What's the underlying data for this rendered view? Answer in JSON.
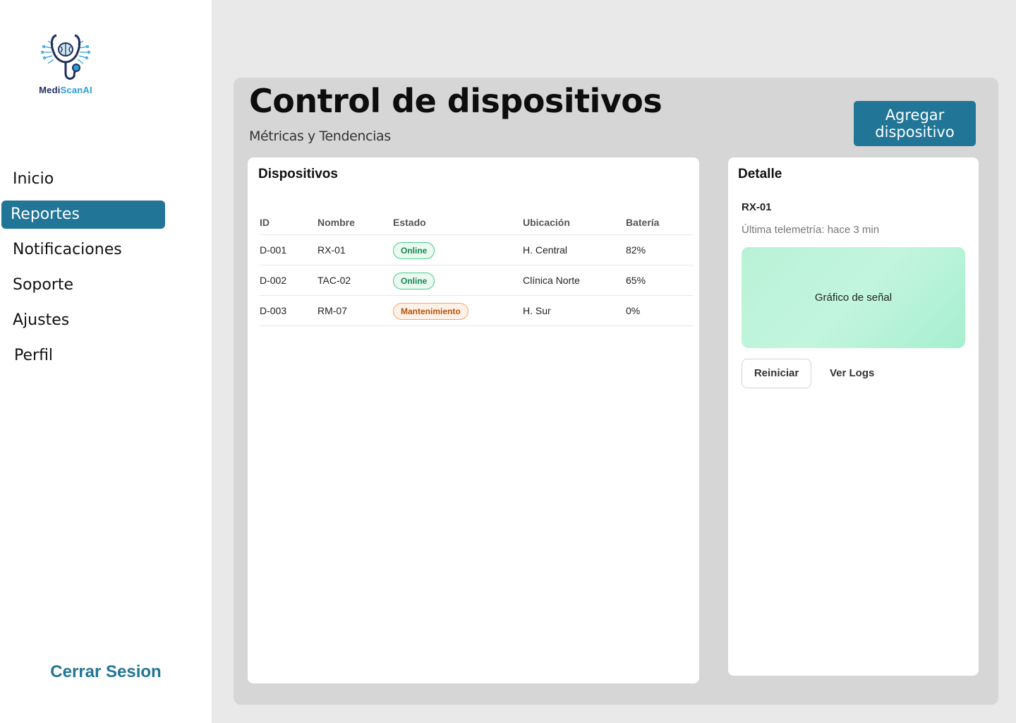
{
  "brand": {
    "name_part1": "Medi",
    "name_part2": "ScanAI",
    "logo_icon": "stethoscope-brain-icon"
  },
  "sidebar": {
    "items": [
      {
        "label": "Inicio",
        "active": false
      },
      {
        "label": "Reportes",
        "active": true
      },
      {
        "label": "Notificaciones",
        "active": false
      },
      {
        "label": "Soporte",
        "active": false
      },
      {
        "label": "Ajustes",
        "active": false
      },
      {
        "label": "Perfil",
        "active": false
      }
    ],
    "logout_label": "Cerrar Sesion"
  },
  "header": {
    "title": "Control de dispositivos",
    "subtitle": "Métricas y Tendencias",
    "add_button_line1": "Agregar",
    "add_button_line2": "dispositivo"
  },
  "devices": {
    "title": "Dispositivos",
    "columns": [
      "ID",
      "Nombre",
      "Estado",
      "Ubicación",
      "Batería"
    ],
    "rows": [
      {
        "id": "D-001",
        "name": "RX-01",
        "state": "Online",
        "location": "H. Central",
        "battery": "82%"
      },
      {
        "id": "D-002",
        "name": "TAC-02",
        "state": "Online",
        "location": "Clínica Norte",
        "battery": "65%"
      },
      {
        "id": "D-003",
        "name": "RM-07",
        "state": "Mantenimiento",
        "location": "H. Sur",
        "battery": "0%"
      }
    ]
  },
  "detail": {
    "title": "Detalle",
    "device_name": "RX-01",
    "telemetry": "Última telemetría: hace 3 min",
    "signal_label": "Gráfico de señal",
    "restart_label": "Reiniciar",
    "logs_label": "Ver Logs"
  },
  "colors": {
    "primary": "#217596",
    "online_text": "#16864f",
    "maintenance_text": "#b3530f",
    "signal_bg": "#b8f2d6"
  }
}
